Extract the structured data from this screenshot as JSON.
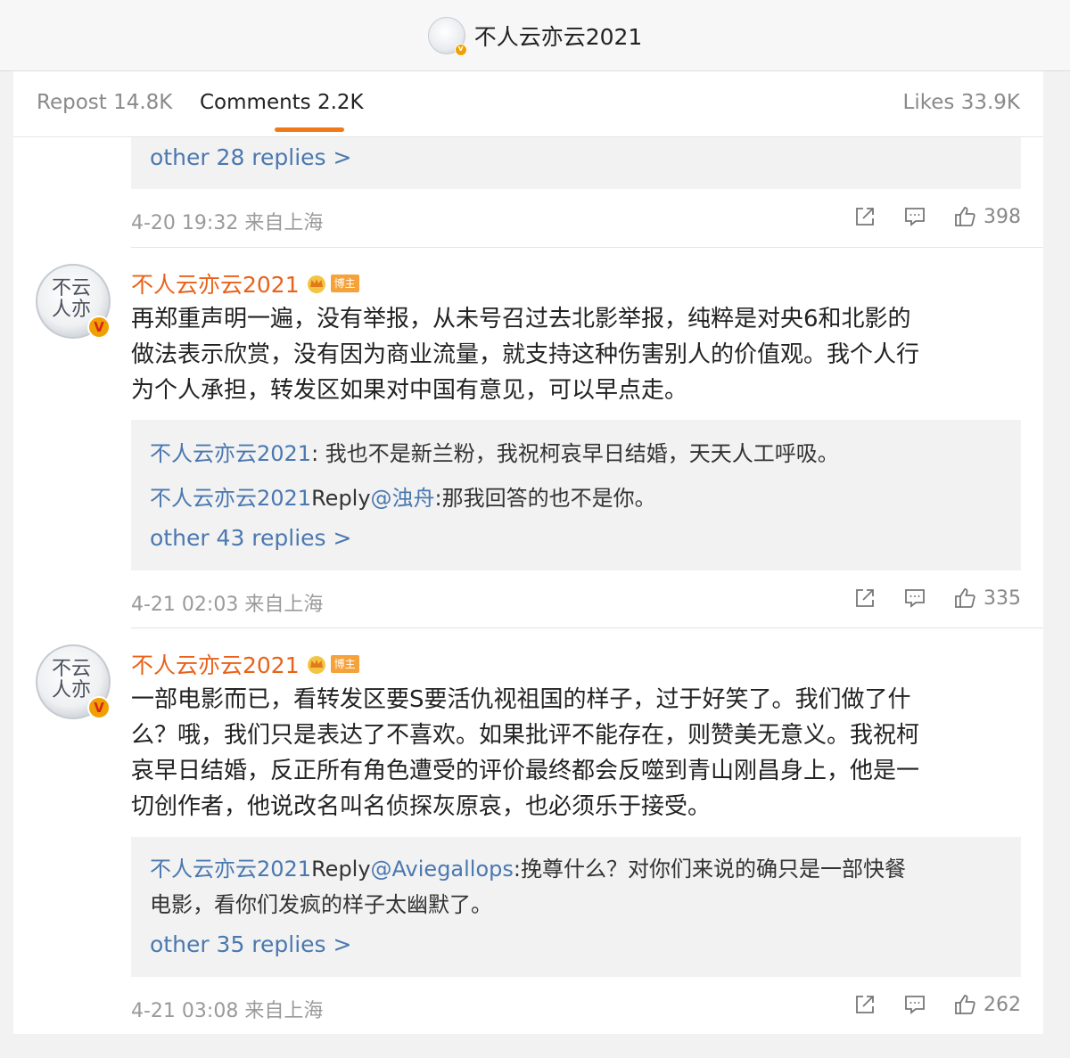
{
  "header": {
    "title": "不人云亦云2021",
    "avatar_icon": "avatar-icon",
    "verified_icon": "verified-badge-icon"
  },
  "tabs": {
    "repost": "Repost 14.8K",
    "comments": "Comments 2.2K",
    "likes": "Likes 33.9K"
  },
  "colors": {
    "accent": "#f07a1a",
    "username": "#e9621a",
    "link": "#4a78b0",
    "badge": "#f6a23a"
  },
  "comments": [
    {
      "reply_box": {
        "more": "other 28 replies >"
      },
      "meta": "4-20 19:32 来自上海",
      "likes": "398"
    },
    {
      "username": "不人云亦云2021",
      "badge": "博主",
      "text_lines": [
        "再郑重声明一遍，没有举报，从未号召过去北影举报，纯粹是对央6和北影的",
        "做法表示欣赏，没有因为商业流量，就支持这种伤害别人的价值观。我个人行",
        "为个人承担，转发区如果对中国有意见，可以早点走。"
      ],
      "reply_box": {
        "replies": [
          {
            "name": "不人云亦云2021",
            "text": ": 我也不是新兰粉，我祝柯哀早日结婚，天天人工呼吸。"
          },
          {
            "name": "不人云亦云2021",
            "reply": "Reply",
            "target": "@浊舟",
            "text": ":那我回答的也不是你。"
          }
        ],
        "more": "other 43 replies >"
      },
      "meta": "4-21 02:03 来自上海",
      "likes": "335"
    },
    {
      "username": "不人云亦云2021",
      "badge": "博主",
      "text_lines": [
        "一部电影而已，看转发区要S要活仇视祖国的样子，过于好笑了。我们做了什",
        "么？哦，我们只是表达了不喜欢。如果批评不能存在，则赞美无意义。我祝柯",
        "哀早日结婚，反正所有角色遭受的评价最终都会反噬到青山刚昌身上，他是一",
        "切创作者，他说改名叫名侦探灰原哀，也必须乐于接受。"
      ],
      "reply_box": {
        "replies": [
          {
            "name": "不人云亦云2021",
            "reply": "Reply",
            "target": "@Aviegallops",
            "text": ":挽尊什么？对你们来说的确只是一部快餐",
            "text2": "电影，看你们发疯的样子太幽默了。"
          }
        ],
        "more": "other 35 replies >"
      },
      "meta": "4-21 03:08 来自上海",
      "likes": "262"
    }
  ]
}
